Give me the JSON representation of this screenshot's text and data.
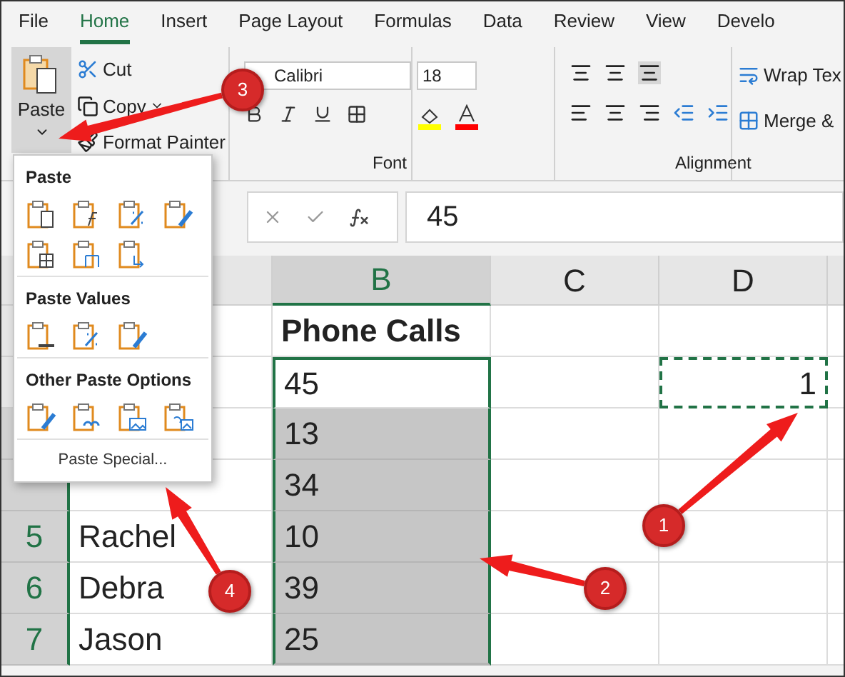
{
  "ribbon_tabs": [
    {
      "label": "File",
      "selected": false
    },
    {
      "label": "Home",
      "selected": true
    },
    {
      "label": "Insert",
      "selected": false
    },
    {
      "label": "Page Layout",
      "selected": false
    },
    {
      "label": "Formulas",
      "selected": false
    },
    {
      "label": "Data",
      "selected": false
    },
    {
      "label": "Review",
      "selected": false
    },
    {
      "label": "View",
      "selected": false
    },
    {
      "label": "Develo",
      "selected": false
    }
  ],
  "clipboard": {
    "paste": "Paste",
    "cut": "Cut",
    "copy": "Copy",
    "format_painter": "Format Painter"
  },
  "font": {
    "name": "Calibri",
    "size": "18",
    "group_label": "Font"
  },
  "alignment": {
    "wrap_text": "Wrap Tex",
    "merge": "Merge &",
    "group_label": "Alignment"
  },
  "formula_bar": {
    "value": "45"
  },
  "columns": [
    {
      "label": "B",
      "selected": true
    },
    {
      "label": "C",
      "selected": false
    },
    {
      "label": "D",
      "selected": false
    }
  ],
  "rows": [
    {
      "header": "",
      "name": "",
      "b": "Phone Calls",
      "d": "",
      "selected": false,
      "copied": false
    },
    {
      "header": "",
      "name": "",
      "b": "45",
      "d": "1",
      "selected": false,
      "copied": true
    },
    {
      "header": "",
      "name": "",
      "b": "13",
      "d": "",
      "selected": true,
      "copied": false
    },
    {
      "header": "",
      "name": "",
      "b": "34",
      "d": "",
      "selected": true,
      "copied": false
    },
    {
      "header": "5",
      "name": "Rachel",
      "b": "10",
      "d": "",
      "selected": true,
      "copied": false
    },
    {
      "header": "6",
      "name": "Debra",
      "b": "39",
      "d": "",
      "selected": true,
      "copied": false
    },
    {
      "header": "7",
      "name": "Jason",
      "b": "25",
      "d": "",
      "selected": true,
      "copied": false
    }
  ],
  "paste_menu": {
    "sections": [
      {
        "title": "Paste",
        "options": [
          {
            "kind": "page"
          },
          {
            "kind": "formula"
          },
          {
            "kind": "percent"
          },
          {
            "kind": "brush"
          },
          {
            "kind": "grid"
          },
          {
            "kind": "width"
          },
          {
            "kind": "transpose"
          }
        ]
      },
      {
        "title": "Paste Values",
        "options": [
          {
            "kind": "values"
          },
          {
            "kind": "percent"
          },
          {
            "kind": "brush"
          }
        ]
      },
      {
        "title": "Other Paste Options",
        "options": [
          {
            "kind": "brush"
          },
          {
            "kind": "link"
          },
          {
            "kind": "image"
          },
          {
            "kind": "linkimage"
          }
        ]
      }
    ],
    "special": "Paste Special..."
  },
  "callouts": [
    {
      "label": "1"
    },
    {
      "label": "2"
    },
    {
      "label": "3"
    },
    {
      "label": "4"
    }
  ]
}
